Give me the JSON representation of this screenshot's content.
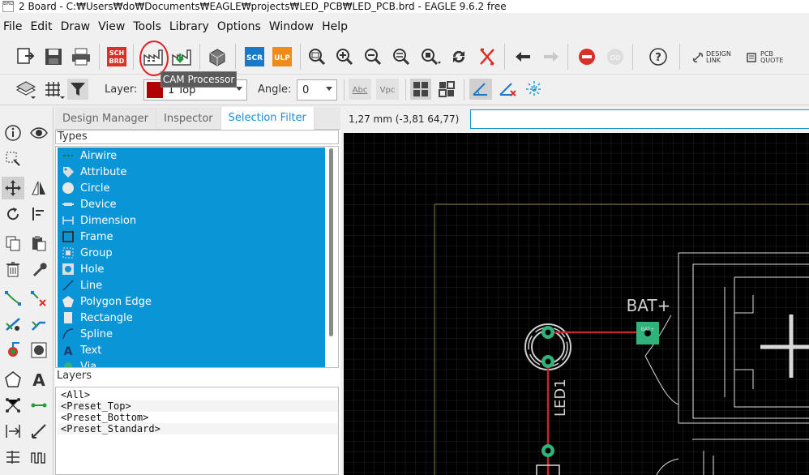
{
  "window": {
    "title": "2 Board - C:₩Users₩do₩Documents₩EAGLE₩projects₩LED_PCB₩LED_PCB.brd - EAGLE 9.6.2 free",
    "icon_label": "BRD"
  },
  "menu": [
    "File",
    "Edit",
    "Draw",
    "View",
    "Tools",
    "Library",
    "Options",
    "Window",
    "Help"
  ],
  "toolbar": {
    "sch_label": "SCH",
    "brd_label": "BRD",
    "scr_label": "SCR",
    "ulp_label": "ULP",
    "design_link": [
      "DESIGN",
      "LINK"
    ],
    "pcb_quote": [
      "PCB",
      "QUOTE"
    ],
    "tooltip": "CAM Processor"
  },
  "param_bar": {
    "layer_label": "Layer:",
    "layer_value": "1 Top",
    "layer_color": "#b00000",
    "angle_label": "Angle:",
    "angle_value": "0",
    "abc_label": "Abc",
    "vpc_label": "Vpc"
  },
  "panel": {
    "tabs": [
      {
        "label": "Design Manager",
        "active": false
      },
      {
        "label": "Inspector",
        "active": false
      },
      {
        "label": "Selection Filter",
        "active": true
      }
    ],
    "types_header": "Types",
    "types": [
      {
        "label": "Airwire",
        "icon": "airwire-icon"
      },
      {
        "label": "Attribute",
        "icon": "tag-icon"
      },
      {
        "label": "Circle",
        "icon": "circle-icon"
      },
      {
        "label": "Device",
        "icon": "device-icon"
      },
      {
        "label": "Dimension",
        "icon": "dimension-icon"
      },
      {
        "label": "Frame",
        "icon": "frame-icon"
      },
      {
        "label": "Group",
        "icon": "group-icon"
      },
      {
        "label": "Hole",
        "icon": "hole-icon"
      },
      {
        "label": "Line",
        "icon": "line-icon"
      },
      {
        "label": "Polygon Edge",
        "icon": "pentagon-icon"
      },
      {
        "label": "Rectangle",
        "icon": "rectangle-icon"
      },
      {
        "label": "Spline",
        "icon": "spline-icon"
      },
      {
        "label": "Text",
        "icon": "text-icon"
      },
      {
        "label": "Via",
        "icon": "via-icon"
      }
    ],
    "layers_header": "Layers",
    "layers": [
      "<All>",
      "<Preset_Top>",
      "<Preset_Bottom>",
      "<Preset_Standard>"
    ]
  },
  "coords": {
    "text": "1,27 mm (-3,81 64,77)"
  },
  "canvas": {
    "part_label_bat": "BAT+",
    "part_label_led": "LED1",
    "pad_label": "BAT+",
    "accent": "#0a95d6",
    "pad_color": "#2fb37a",
    "trace_color": "#c0262b"
  }
}
